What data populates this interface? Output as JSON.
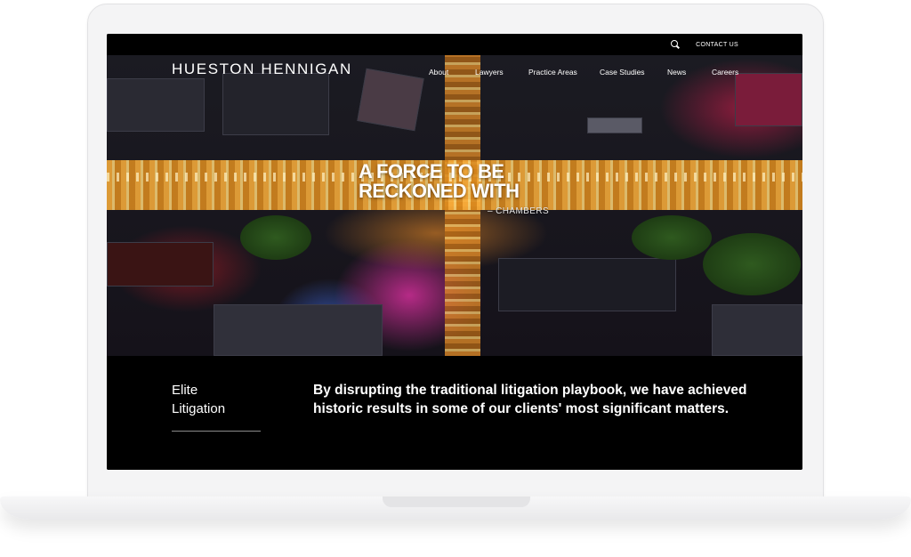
{
  "header": {
    "contact_label": "CONTACT US",
    "search_icon": "search-icon"
  },
  "brand": {
    "logo_text": "HUESTON HENNIGAN"
  },
  "nav": {
    "items": [
      {
        "label": "About"
      },
      {
        "label": "Lawyers"
      },
      {
        "label": "Practice Areas"
      },
      {
        "label": "Case Studies"
      },
      {
        "label": "News"
      },
      {
        "label": "Careers"
      }
    ]
  },
  "hero": {
    "headline_line1": "A FORCE TO BE",
    "headline_line2": "RECKONED WITH",
    "attribution": "– CHAMBERS"
  },
  "intro": {
    "label_line1": "Elite",
    "label_line2": "Litigation",
    "text": "By disrupting the traditional litigation playbook, we have achieved historic results in some of our clients' most significant matters."
  },
  "colors": {
    "background": "#000000",
    "text": "#ffffff",
    "frame": "#f4f4f5"
  }
}
